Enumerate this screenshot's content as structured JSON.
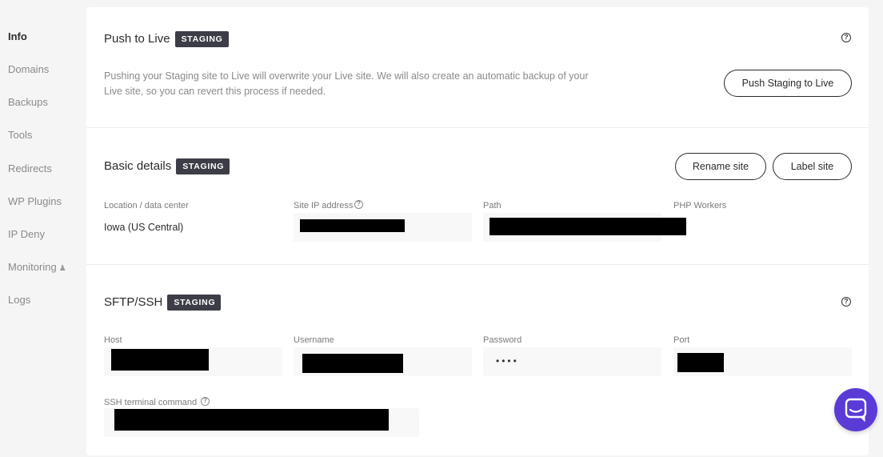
{
  "sidebar": {
    "items": [
      {
        "label": "Info",
        "active": true
      },
      {
        "label": "Domains"
      },
      {
        "label": "Backups"
      },
      {
        "label": "Tools"
      },
      {
        "label": "Redirects"
      },
      {
        "label": "WP Plugins"
      },
      {
        "label": "IP Deny"
      },
      {
        "label": "Monitoring",
        "icon": "lock-icon"
      },
      {
        "label": "Logs"
      }
    ]
  },
  "push_to_live": {
    "title": "Push to Live",
    "badge": "STAGING",
    "description": "Pushing your Staging site to Live will overwrite your Live site. We will also create an automatic backup of your Live site, so you can revert this process if needed.",
    "button": "Push Staging to Live",
    "help_icon": "question-circle-icon"
  },
  "basic_details": {
    "title": "Basic details",
    "badge": "STAGING",
    "rename_button": "Rename site",
    "label_button": "Label site",
    "fields": {
      "location_label": "Location / data center",
      "location_value": "Iowa (US Central)",
      "ip_label": "Site IP address",
      "path_label": "Path",
      "php_label": "PHP Workers"
    }
  },
  "sftp": {
    "title": "SFTP/SSH",
    "badge": "STAGING",
    "help_icon": "question-circle-icon",
    "fields": {
      "host_label": "Host",
      "username_label": "Username",
      "password_label": "Password",
      "password_value": "••••",
      "port_label": "Port",
      "ssh_label": "SSH terminal command"
    }
  },
  "chat": {
    "icon": "chat-bubble-icon",
    "color": "#5b3bd6"
  },
  "colors": {
    "badge": "#3d3d47",
    "accent": "#5b3bd6"
  }
}
